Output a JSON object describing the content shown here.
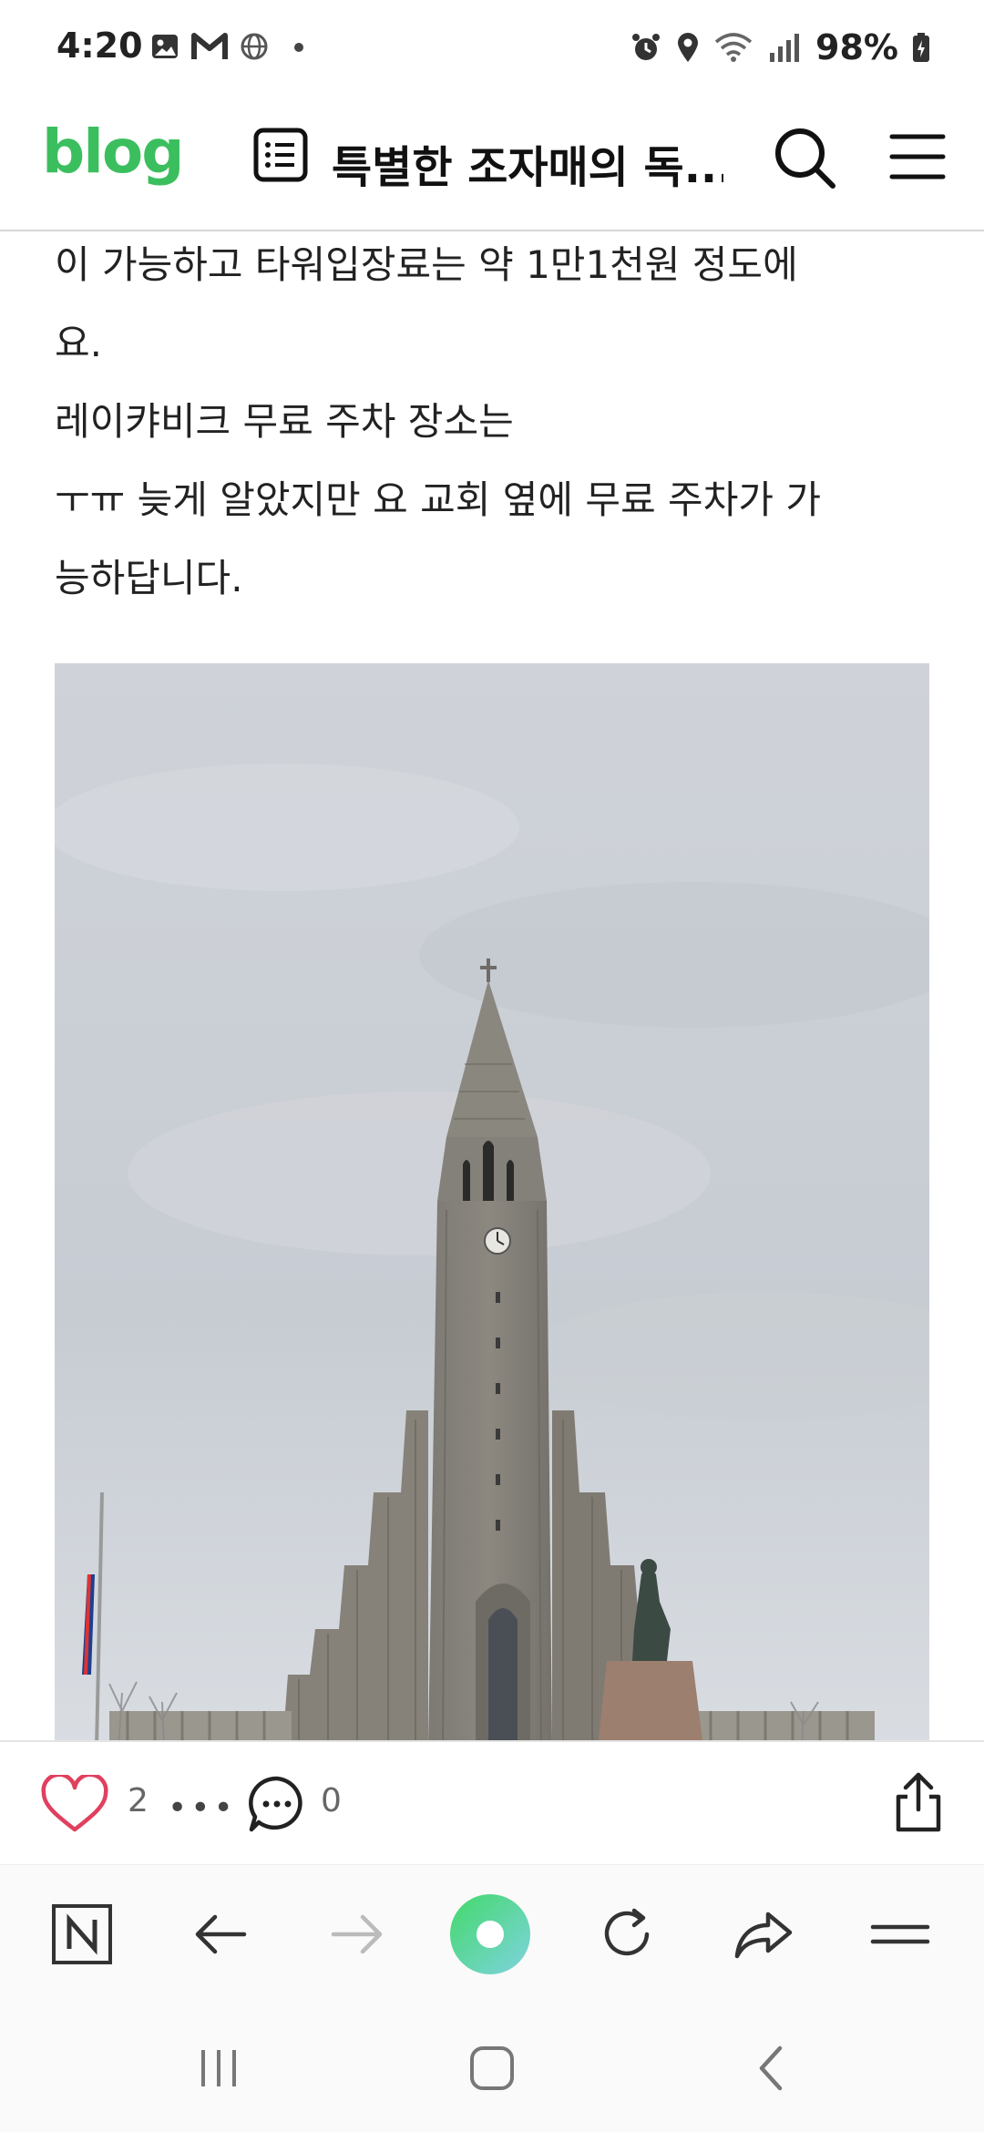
{
  "status_bar": {
    "time": "4:20",
    "notification_icons": [
      "gallery-icon",
      "gmail-icon",
      "globe-icon",
      "dot-icon"
    ],
    "system_icons": [
      "alarm-icon",
      "location-icon",
      "wifi-icon",
      "signal-icon"
    ],
    "battery": "98%"
  },
  "header": {
    "logo": "blog",
    "title": "특별한 조자매의 독...",
    "icons": [
      "list-icon",
      "search-icon",
      "menu-icon"
    ]
  },
  "post": {
    "lines": [
      "이 가능하고 타워입장료는 약 1만1천원 정도에",
      "요.",
      "레이캬비크 무료 주차 장소는",
      "ㅜㅠ 늦게 알았지만 요 교회 옆에 무료 주차가 가",
      "능하답니다."
    ],
    "image_description_icon": "church-photo"
  },
  "actions": {
    "like_count": "2",
    "more": "•••",
    "comment_count": "0"
  },
  "browser_toolbar": {
    "items": [
      "naver-home-icon",
      "back-icon",
      "forward-icon",
      "green-dot-icon",
      "refresh-icon",
      "share-arrow-icon",
      "menu-lines-icon"
    ]
  },
  "colors": {
    "brand_green": "#3bbf5e",
    "like_pink": "#e0405e"
  }
}
